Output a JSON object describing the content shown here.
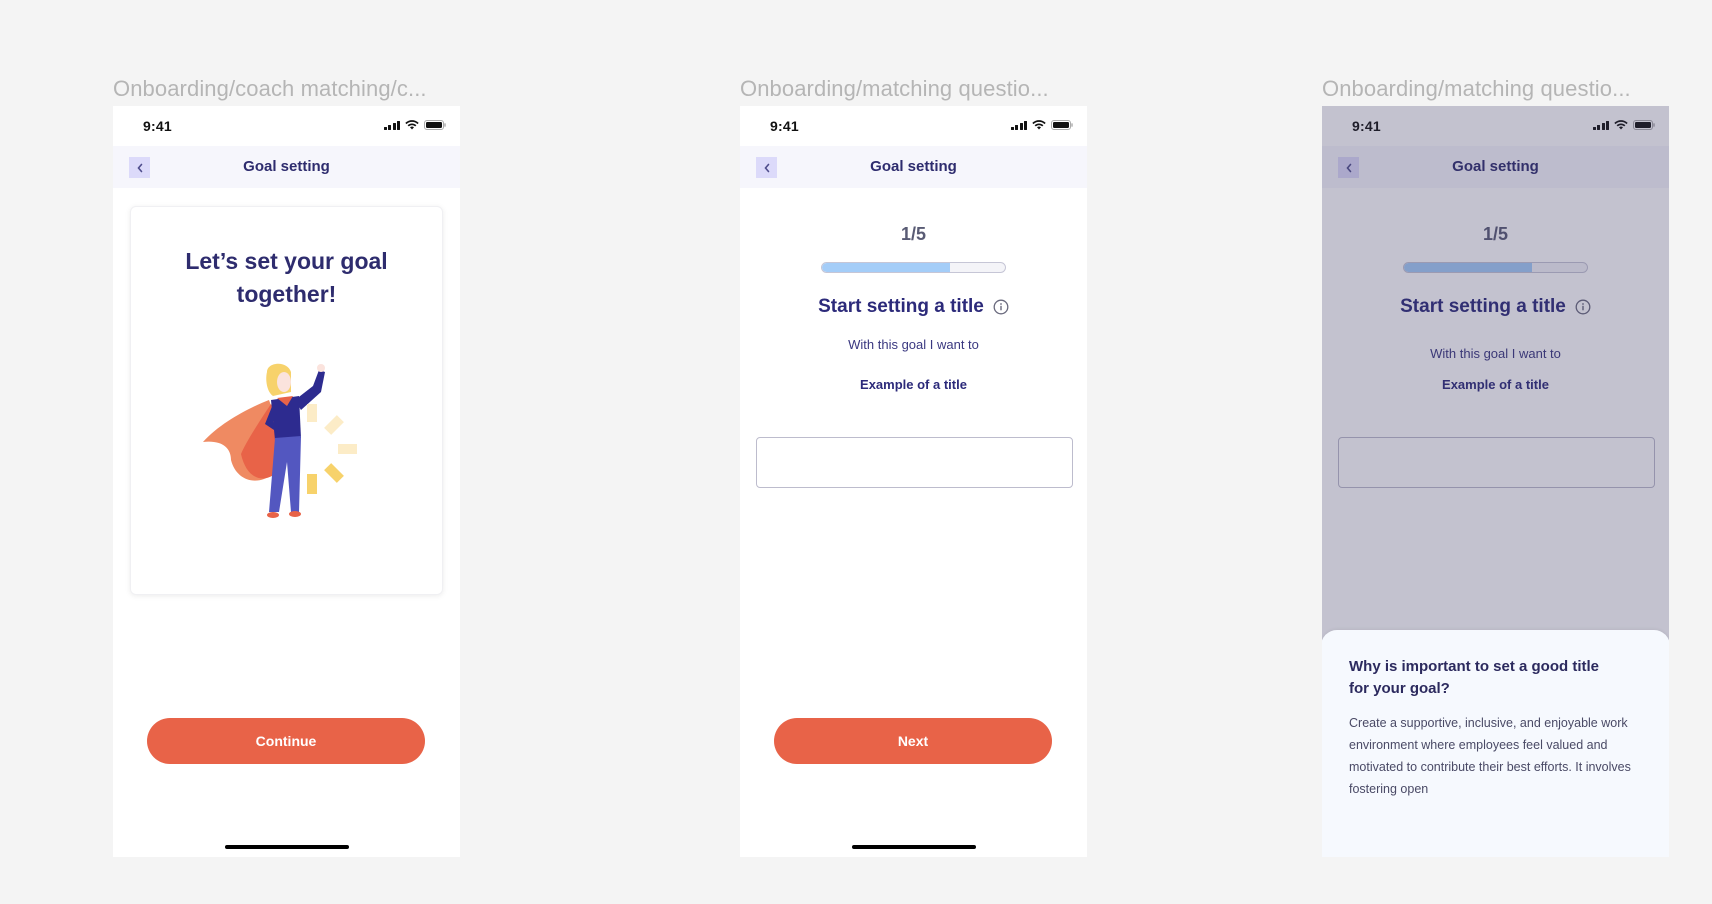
{
  "frames": [
    {
      "label": "Onboarding/coach matching/c...",
      "status_time": "9:41",
      "nav_title": "Goal setting",
      "card_title": "Let’s set your goal together!",
      "illustration": "superhero-woman-with-cape",
      "primary_button": "Continue"
    },
    {
      "label": "Onboarding/matching questio...",
      "status_time": "9:41",
      "nav_title": "Goal setting",
      "step": "1/5",
      "progress_percent": 70,
      "question_title": "Start setting a title",
      "question_sub": "With this goal I want to",
      "example_title": "Example of a title",
      "input_value": "",
      "input_placeholder": "",
      "primary_button": "Next"
    },
    {
      "label": "Onboarding/matching questio...",
      "status_time": "9:41",
      "nav_title": "Goal setting",
      "step": "1/5",
      "progress_percent": 70,
      "question_title": "Start setting a title",
      "question_sub": "With this goal I want to",
      "example_title": "Example of a title",
      "input_value": "",
      "input_placeholder": "",
      "sheet": {
        "title": "Why is important to set a good title for your goal?",
        "body": "Create a supportive, inclusive, and enjoyable work environment where employees feel valued and motivated to contribute their best efforts. It involves fostering open"
      }
    }
  ],
  "icons": {
    "back": "chevron-left-icon",
    "info": "info-circle-icon",
    "signal": "cellular-signal-icon",
    "wifi": "wifi-icon",
    "battery": "battery-icon"
  },
  "colors": {
    "primary": "#e86348",
    "heading": "#2e2c6e",
    "progress_fill": "#a4cdf8",
    "nav_bg": "#f6f6fc",
    "back_btn_bg": "#dcdafa",
    "canvas_bg": "#f4f4f4"
  }
}
